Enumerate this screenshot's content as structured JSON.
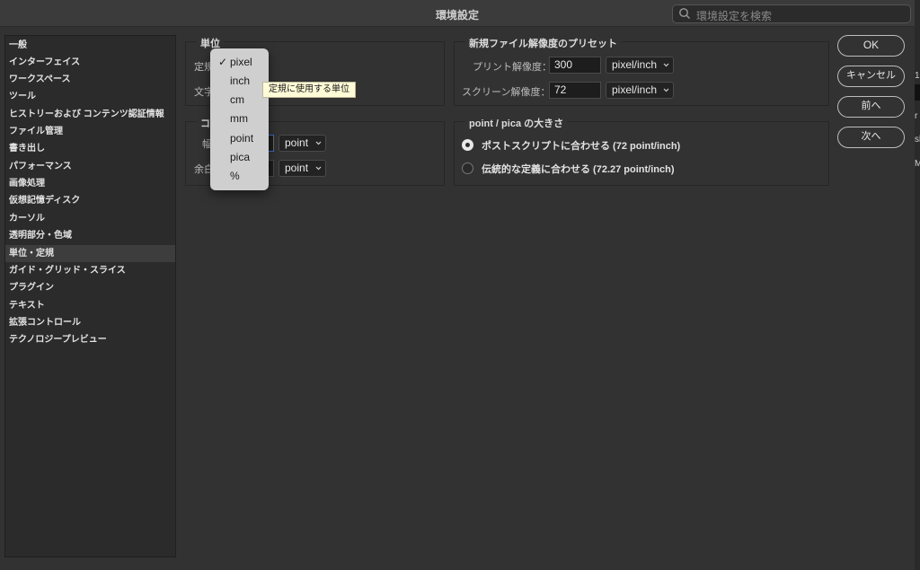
{
  "window": {
    "title": "環境設定"
  },
  "search": {
    "placeholder": "環境設定を検索"
  },
  "sidebar": {
    "items": [
      "一般",
      "インターフェイス",
      "ワークスペース",
      "ツール",
      "ヒストリーおよび コンテンツ認証情報",
      "ファイル管理",
      "書き出し",
      "パフォーマンス",
      "画像処理",
      "仮想記憶ディスク",
      "カーソル",
      "透明部分・色域",
      "単位・定規",
      "ガイド・グリッド・スライス",
      "プラグイン",
      "テキスト",
      "拡張コントロール",
      "テクノロジープレビュー"
    ],
    "selected": "単位・定規"
  },
  "units": {
    "legend": "単位",
    "ruler_label": "定規",
    "type_label": "文字"
  },
  "columns": {
    "legend": "コ",
    "width_label": "幅",
    "width_unit": "point",
    "gutter_label": "余白",
    "gutter_unit": "point"
  },
  "presets": {
    "legend": "新規ファイル解像度のプリセット",
    "print_label": "プリント解像度：",
    "print_value": "300",
    "print_unit": "pixel/inch",
    "screen_label": "スクリーン解像度：",
    "screen_value": "72",
    "screen_unit": "pixel/inch"
  },
  "point_size": {
    "legend": "point / pica の大きさ",
    "postscript_label": "ポストスクリプトに合わせる (72 point/inch)",
    "traditional_label": "伝統的な定義に合わせる (72.27 point/inch)",
    "selected": "postscript"
  },
  "buttons": {
    "ok": "OK",
    "cancel": "キャンセル",
    "prev": "前へ",
    "next": "次へ"
  },
  "unit_menu": {
    "items": [
      "pixel",
      "inch",
      "cm",
      "mm",
      "point",
      "pica",
      "%"
    ],
    "checked": "pixel",
    "check_mark": "✓"
  },
  "tooltip": {
    "text": "定規に使用する単位"
  },
  "right_strip": {
    "texts": [
      "1(",
      "r",
      "sl",
      "Ma"
    ]
  },
  "icons": {
    "search": "search-icon",
    "chevron": "chevron-down-icon",
    "check": "checkmark-icon"
  }
}
